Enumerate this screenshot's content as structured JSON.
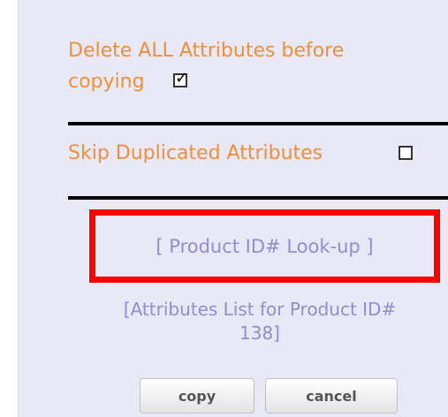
{
  "form": {
    "delete_all_line1": "Delete ALL Attributes before",
    "delete_all_line2": "copying",
    "delete_all_checked": true,
    "skip_duplicated_label": "Skip Duplicated Attributes",
    "skip_duplicated_checked": false,
    "lookup_link": "[ Product ID# Look-up ]",
    "attributes_list_line1": "[Attributes List for Product ID#",
    "attributes_list_line2": "138]",
    "copy_button": "copy",
    "cancel_button": "cancel"
  },
  "colors": {
    "label_orange": "#ee8f3c",
    "link_purple": "#8e8ed0",
    "highlight_red": "#ff0000",
    "panel_bg": "#e8e8f6"
  }
}
